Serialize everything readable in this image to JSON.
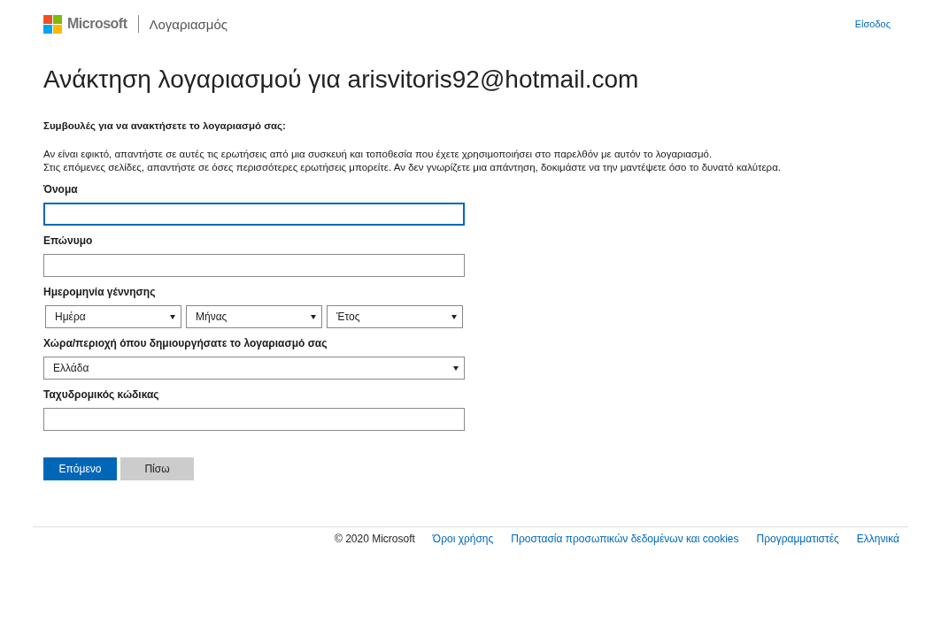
{
  "header": {
    "brand": "Microsoft",
    "section": "Λογαριασμός",
    "sign_in": "Είσοδος"
  },
  "title": "Ανάκτηση λογαριασμού για arisvitoris92@hotmail.com",
  "tips_heading": "Συμβουλές για να ανακτήσετε το λογαριασμό σας:",
  "tips": [
    "Αν είναι εφικτό, απαντήστε σε αυτές τις ερωτήσεις από μια συσκευή και τοποθεσία που έχετε χρησιμοποιήσει στο παρελθόν με αυτόν το λογαριασμό.",
    "Στις επόμενες σελίδες, απαντήστε σε όσες περισσότερες ερωτήσεις μπορείτε. Αν δεν γνωρίζετε μια απάντηση, δοκιμάστε να την μαντέψετε όσο το δυνατό καλύτερα."
  ],
  "fields": [
    {
      "label": "Όνομα",
      "kind": "text",
      "focused": true
    },
    {
      "label": "Επώνυμο",
      "kind": "text",
      "focused": false
    },
    {
      "label": "Ημερομηνία γέννησης",
      "kind": "date",
      "selects": [
        "Ημέρα",
        "Μήνας",
        "Έτος"
      ]
    },
    {
      "label": "Χώρα/περιοχή όπου δημιουργήσατε το λογαριασμό σας",
      "kind": "select",
      "value": "Ελλάδα"
    },
    {
      "label": "Ταχυδρομικός κώδικας",
      "kind": "text",
      "focused": false
    }
  ],
  "buttons": [
    {
      "label": "Επόμενο",
      "kind": "primary"
    },
    {
      "label": "Πίσω",
      "kind": "secondary"
    }
  ],
  "footer": {
    "copyright": "© 2020 Microsoft",
    "links": [
      "Όροι χρήσης",
      "Προστασία προσωπικών δεδομένων και cookies",
      "Προγραμματιστές",
      "Ελληνικά"
    ]
  }
}
